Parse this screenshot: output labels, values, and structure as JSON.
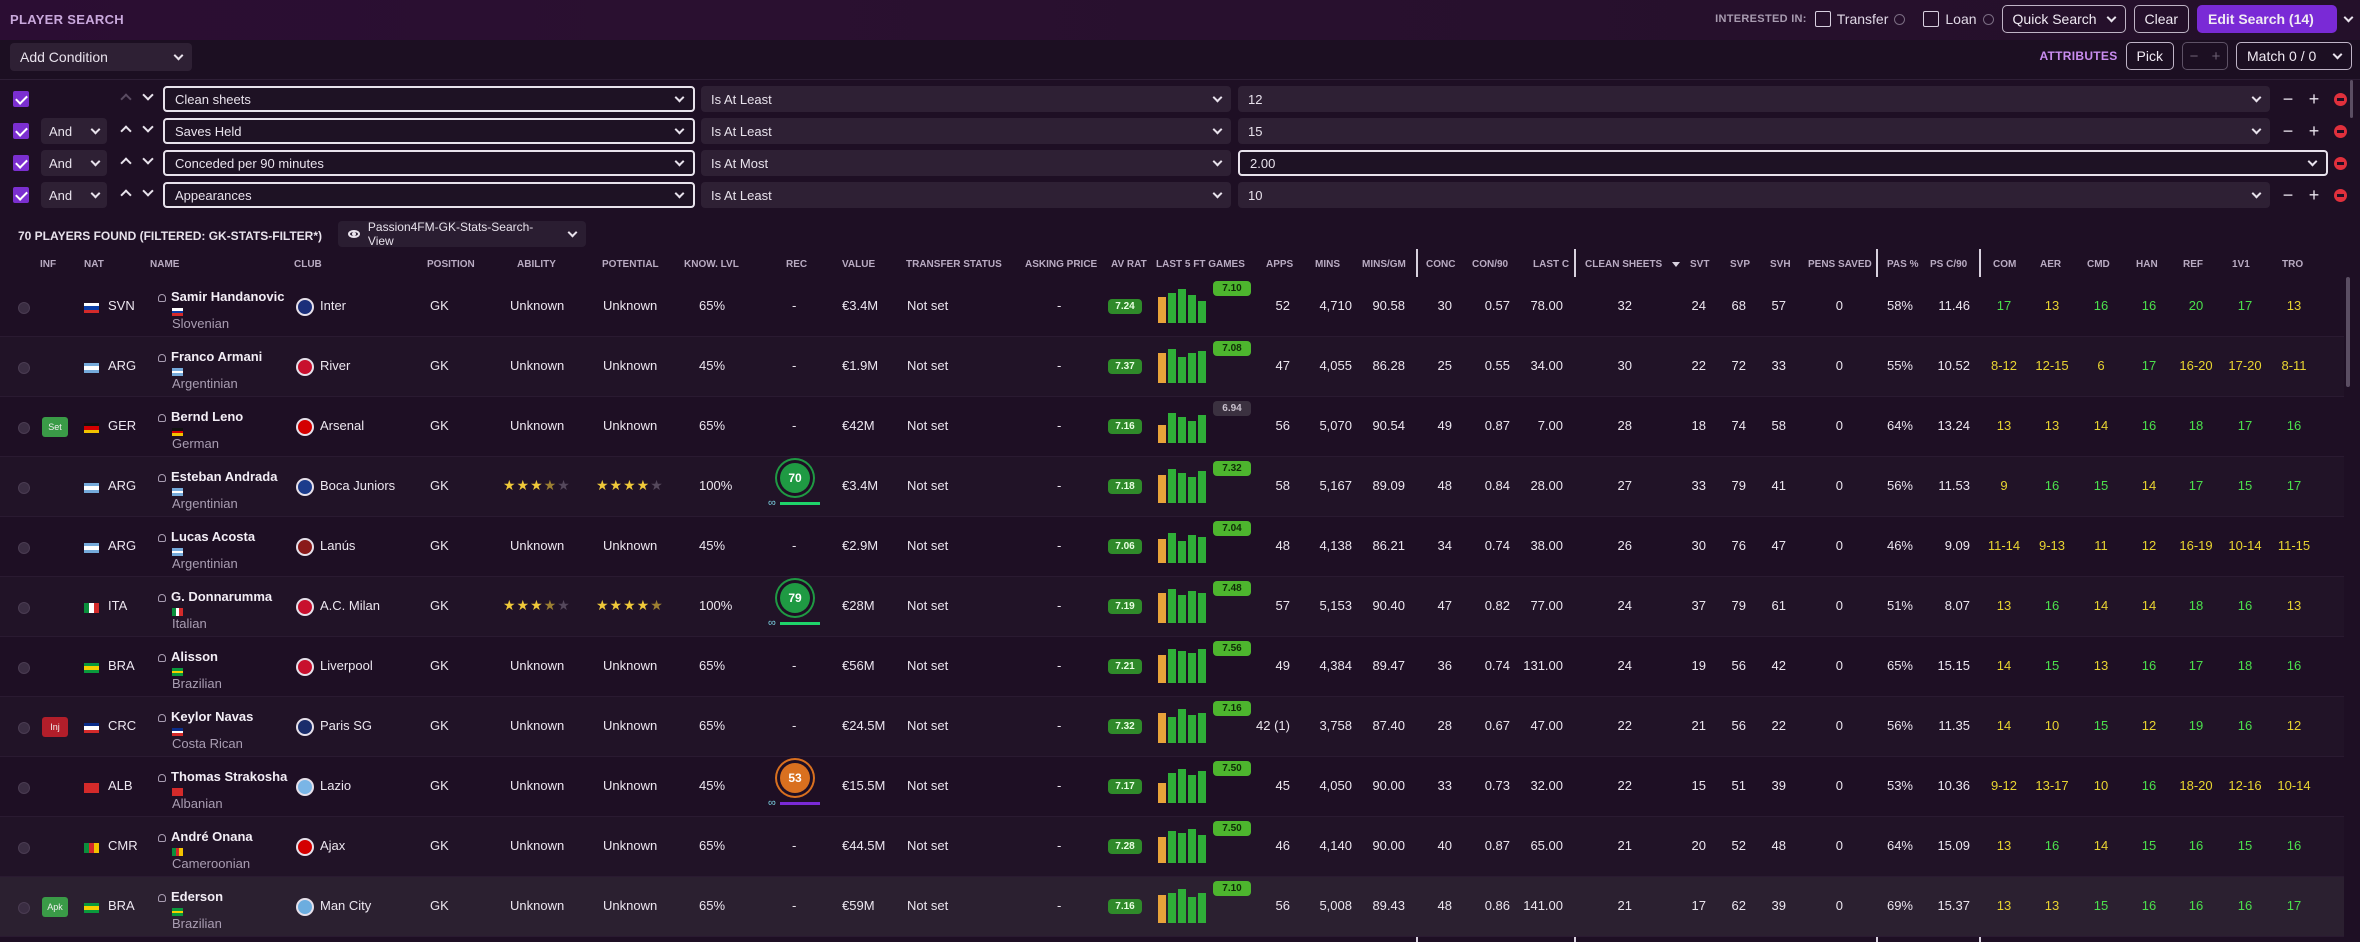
{
  "header": {
    "title": "PLAYER SEARCH",
    "interested_in_label": "INTERESTED IN:",
    "transfer_label": "Transfer",
    "loan_label": "Loan",
    "quick_search_label": "Quick Search",
    "clear_label": "Clear",
    "edit_search_label": "Edit Search (14)"
  },
  "conditions_bar": {
    "add_condition_label": "Add Condition",
    "attributes_label": "ATTRIBUTES",
    "pick_label": "Pick",
    "minus_label": "−",
    "plus_label": "+",
    "match_label": "Match 0 / 0"
  },
  "conditions": [
    {
      "joiner": "",
      "attribute": "Clean sheets",
      "operator": "Is At Least",
      "value": "12",
      "checked": true
    },
    {
      "joiner": "And",
      "attribute": "Saves Held",
      "operator": "Is At Least",
      "value": "15",
      "checked": true
    },
    {
      "joiner": "And",
      "attribute": "Conceded per 90 minutes",
      "operator": "Is At Most",
      "value": "2.00",
      "checked": true
    },
    {
      "joiner": "And",
      "attribute": "Appearances",
      "operator": "Is At Least",
      "value": "10",
      "checked": true
    }
  ],
  "results": {
    "found_label": "70 PLAYERS FOUND (FILTERED: GK-STATS-FILTER*)",
    "view_label": "Passion4FM-GK-Stats-Search-View"
  },
  "columns": {
    "inf": "INF",
    "nat": "NAT",
    "name": "NAME",
    "club": "CLUB",
    "position": "POSITION",
    "ability": "ABILITY",
    "potential": "POTENTIAL",
    "know": "KNOW. LVL",
    "rec": "REC",
    "value": "VALUE",
    "transfer_status": "TRANSFER STATUS",
    "asking": "ASKING PRICE",
    "avrat": "AV RAT",
    "last5": "LAST 5 FT GAMES",
    "apps": "APPS",
    "mins": "MINS",
    "minsgm": "MINS/GM",
    "conc": "CONC",
    "con90": "CON/90",
    "lastc": "LAST C",
    "cs": "CLEAN SHEETS",
    "svt": "SVT",
    "svp": "SVP",
    "svh": "SVH",
    "pens": "PENS SAVED",
    "pas": "PAS %",
    "psc": "PS C/90",
    "com": "COM",
    "aer": "AER",
    "cmd": "CMD",
    "han": "HAN",
    "ref": "REF",
    "one": "1V1",
    "tro": "TRO"
  },
  "colors": {
    "accent": "#7a2ad6",
    "attr_green": "#4ce04c",
    "attr_yellow": "#e8d431",
    "rating_green": "#2f8a2a"
  },
  "players": [
    {
      "inf": "",
      "nat": "SVN",
      "name": "Samir Handanovic",
      "nationality": "Slovenian",
      "club": "Inter",
      "position": "GK",
      "ability": "Unknown",
      "potential": "Unknown",
      "know": "65%",
      "rec": "-",
      "value": "€3.4M",
      "transfer_status": "Not set",
      "asking": "-",
      "avrat": "7.24",
      "last5": "7.10",
      "apps": "52",
      "mins": "4,710",
      "minsgm": "90.58",
      "conc": "30",
      "con90": "0.57",
      "lastc": "78.00",
      "cs": "32",
      "svt": "24",
      "svp": "68",
      "svh": "57",
      "pens": "0",
      "pas": "58%",
      "psc": "11.46",
      "com": "17",
      "aer": "13",
      "cmd": "16",
      "han": "16",
      "ref": "20",
      "one": "17",
      "tro": "13"
    },
    {
      "inf": "",
      "nat": "ARG",
      "name": "Franco Armani",
      "nationality": "Argentinian",
      "club": "River",
      "position": "GK",
      "ability": "Unknown",
      "potential": "Unknown",
      "know": "45%",
      "rec": "-",
      "value": "€1.9M",
      "transfer_status": "Not set",
      "asking": "-",
      "avrat": "7.37",
      "last5": "7.08",
      "apps": "47",
      "mins": "4,055",
      "minsgm": "86.28",
      "conc": "25",
      "con90": "0.55",
      "lastc": "34.00",
      "cs": "30",
      "svt": "22",
      "svp": "72",
      "svh": "33",
      "pens": "0",
      "pas": "55%",
      "psc": "10.52",
      "com": "8-12",
      "aer": "12-15",
      "cmd": "6",
      "han": "17",
      "ref": "16-20",
      "one": "17-20",
      "tro": "8-11"
    },
    {
      "inf": "Set",
      "nat": "GER",
      "name": "Bernd Leno",
      "nationality": "German",
      "club": "Arsenal",
      "position": "GK",
      "ability": "Unknown",
      "potential": "Unknown",
      "know": "65%",
      "rec": "-",
      "value": "€42M",
      "transfer_status": "Not set",
      "asking": "-",
      "avrat": "7.16",
      "last5": "6.94",
      "apps": "56",
      "mins": "5,070",
      "minsgm": "90.54",
      "conc": "49",
      "con90": "0.87",
      "lastc": "7.00",
      "cs": "28",
      "svt": "18",
      "svp": "74",
      "svh": "58",
      "pens": "0",
      "pas": "64%",
      "psc": "13.24",
      "com": "13",
      "aer": "13",
      "cmd": "14",
      "han": "16",
      "ref": "18",
      "one": "17",
      "tro": "16"
    },
    {
      "inf": "",
      "nat": "ARG",
      "name": "Esteban Andrada",
      "nationality": "Argentinian",
      "club": "Boca Juniors",
      "position": "GK",
      "ability": "★★★★",
      "potential": "★★★★",
      "know": "100%",
      "rec": "70",
      "value": "€3.4M",
      "transfer_status": "Not set",
      "asking": "-",
      "avrat": "7.18",
      "last5": "7.32",
      "apps": "58",
      "mins": "5,167",
      "minsgm": "89.09",
      "conc": "48",
      "con90": "0.84",
      "lastc": "28.00",
      "cs": "27",
      "svt": "33",
      "svp": "79",
      "svh": "41",
      "pens": "0",
      "pas": "56%",
      "psc": "11.53",
      "com": "9",
      "aer": "16",
      "cmd": "15",
      "han": "14",
      "ref": "17",
      "one": "15",
      "tro": "17"
    },
    {
      "inf": "",
      "nat": "ARG",
      "name": "Lucas Acosta",
      "nationality": "Argentinian",
      "club": "Lanús",
      "position": "GK",
      "ability": "Unknown",
      "potential": "Unknown",
      "know": "45%",
      "rec": "-",
      "value": "€2.9M",
      "transfer_status": "Not set",
      "asking": "-",
      "avrat": "7.06",
      "last5": "7.04",
      "apps": "48",
      "mins": "4,138",
      "minsgm": "86.21",
      "conc": "34",
      "con90": "0.74",
      "lastc": "38.00",
      "cs": "26",
      "svt": "30",
      "svp": "76",
      "svh": "47",
      "pens": "0",
      "pas": "46%",
      "psc": "9.09",
      "com": "11-14",
      "aer": "9-13",
      "cmd": "11",
      "han": "12",
      "ref": "16-19",
      "one": "10-14",
      "tro": "11-15"
    },
    {
      "inf": "",
      "nat": "ITA",
      "name": "G. Donnarumma",
      "nationality": "Italian",
      "club": "A.C. Milan",
      "position": "GK",
      "ability": "★★★★",
      "potential": "★★★★★",
      "know": "100%",
      "rec": "79",
      "value": "€28M",
      "transfer_status": "Not set",
      "asking": "-",
      "avrat": "7.19",
      "last5": "7.48",
      "apps": "57",
      "mins": "5,153",
      "minsgm": "90.40",
      "conc": "47",
      "con90": "0.82",
      "lastc": "77.00",
      "cs": "24",
      "svt": "37",
      "svp": "79",
      "svh": "61",
      "pens": "0",
      "pas": "51%",
      "psc": "8.07",
      "com": "13",
      "aer": "16",
      "cmd": "14",
      "han": "14",
      "ref": "18",
      "one": "16",
      "tro": "13"
    },
    {
      "inf": "",
      "nat": "BRA",
      "name": "Alisson",
      "nationality": "Brazilian",
      "club": "Liverpool",
      "position": "GK",
      "ability": "Unknown",
      "potential": "Unknown",
      "know": "65%",
      "rec": "-",
      "value": "€56M",
      "transfer_status": "Not set",
      "asking": "-",
      "avrat": "7.21",
      "last5": "7.56",
      "apps": "49",
      "mins": "4,384",
      "minsgm": "89.47",
      "conc": "36",
      "con90": "0.74",
      "lastc": "131.00",
      "cs": "24",
      "svt": "19",
      "svp": "56",
      "svh": "42",
      "pens": "0",
      "pas": "65%",
      "psc": "15.15",
      "com": "14",
      "aer": "15",
      "cmd": "13",
      "han": "16",
      "ref": "17",
      "one": "18",
      "tro": "16"
    },
    {
      "inf": "Inj",
      "nat": "CRC",
      "name": "Keylor Navas",
      "nationality": "Costa Rican",
      "club": "Paris SG",
      "position": "GK",
      "ability": "Unknown",
      "potential": "Unknown",
      "know": "65%",
      "rec": "-",
      "value": "€24.5M",
      "transfer_status": "Not set",
      "asking": "-",
      "avrat": "7.32",
      "last5": "7.16",
      "apps": "42 (1)",
      "mins": "3,758",
      "minsgm": "87.40",
      "conc": "28",
      "con90": "0.67",
      "lastc": "47.00",
      "cs": "22",
      "svt": "21",
      "svp": "56",
      "svh": "22",
      "pens": "0",
      "pas": "56%",
      "psc": "11.35",
      "com": "14",
      "aer": "10",
      "cmd": "15",
      "han": "12",
      "ref": "19",
      "one": "16",
      "tro": "12"
    },
    {
      "inf": "",
      "nat": "ALB",
      "name": "Thomas Strakosha",
      "nationality": "Albanian",
      "club": "Lazio",
      "position": "GK",
      "ability": "Unknown",
      "potential": "Unknown",
      "know": "45%",
      "rec": "53",
      "value": "€15.5M",
      "transfer_status": "Not set",
      "asking": "-",
      "avrat": "7.17",
      "last5": "7.50",
      "apps": "45",
      "mins": "4,050",
      "minsgm": "90.00",
      "conc": "33",
      "con90": "0.73",
      "lastc": "32.00",
      "cs": "22",
      "svt": "15",
      "svp": "51",
      "svh": "39",
      "pens": "0",
      "pas": "53%",
      "psc": "10.36",
      "com": "9-12",
      "aer": "13-17",
      "cmd": "10",
      "han": "16",
      "ref": "18-20",
      "one": "12-16",
      "tro": "10-14"
    },
    {
      "inf": "",
      "nat": "CMR",
      "name": "André Onana",
      "nationality": "Cameroonian",
      "club": "Ajax",
      "position": "GK",
      "ability": "Unknown",
      "potential": "Unknown",
      "know": "65%",
      "rec": "-",
      "value": "€44.5M",
      "transfer_status": "Not set",
      "asking": "-",
      "avrat": "7.28",
      "last5": "7.50",
      "apps": "46",
      "mins": "4,140",
      "minsgm": "90.00",
      "conc": "40",
      "con90": "0.87",
      "lastc": "65.00",
      "cs": "21",
      "svt": "20",
      "svp": "52",
      "svh": "48",
      "pens": "0",
      "pas": "64%",
      "psc": "15.09",
      "com": "13",
      "aer": "16",
      "cmd": "14",
      "han": "15",
      "ref": "16",
      "one": "15",
      "tro": "16"
    },
    {
      "inf": "Apk",
      "nat": "BRA",
      "name": "Ederson",
      "nationality": "Brazilian",
      "club": "Man City",
      "position": "GK",
      "ability": "Unknown",
      "potential": "Unknown",
      "know": "65%",
      "rec": "-",
      "value": "€59M",
      "transfer_status": "Not set",
      "asking": "-",
      "avrat": "7.16",
      "last5": "7.10",
      "apps": "56",
      "mins": "5,008",
      "minsgm": "89.43",
      "conc": "48",
      "con90": "0.86",
      "lastc": "141.00",
      "cs": "21",
      "svt": "17",
      "svp": "62",
      "svh": "39",
      "pens": "0",
      "pas": "69%",
      "psc": "15.37",
      "com": "13",
      "aer": "13",
      "cmd": "15",
      "han": "16",
      "ref": "16",
      "one": "16",
      "tro": "17"
    }
  ]
}
